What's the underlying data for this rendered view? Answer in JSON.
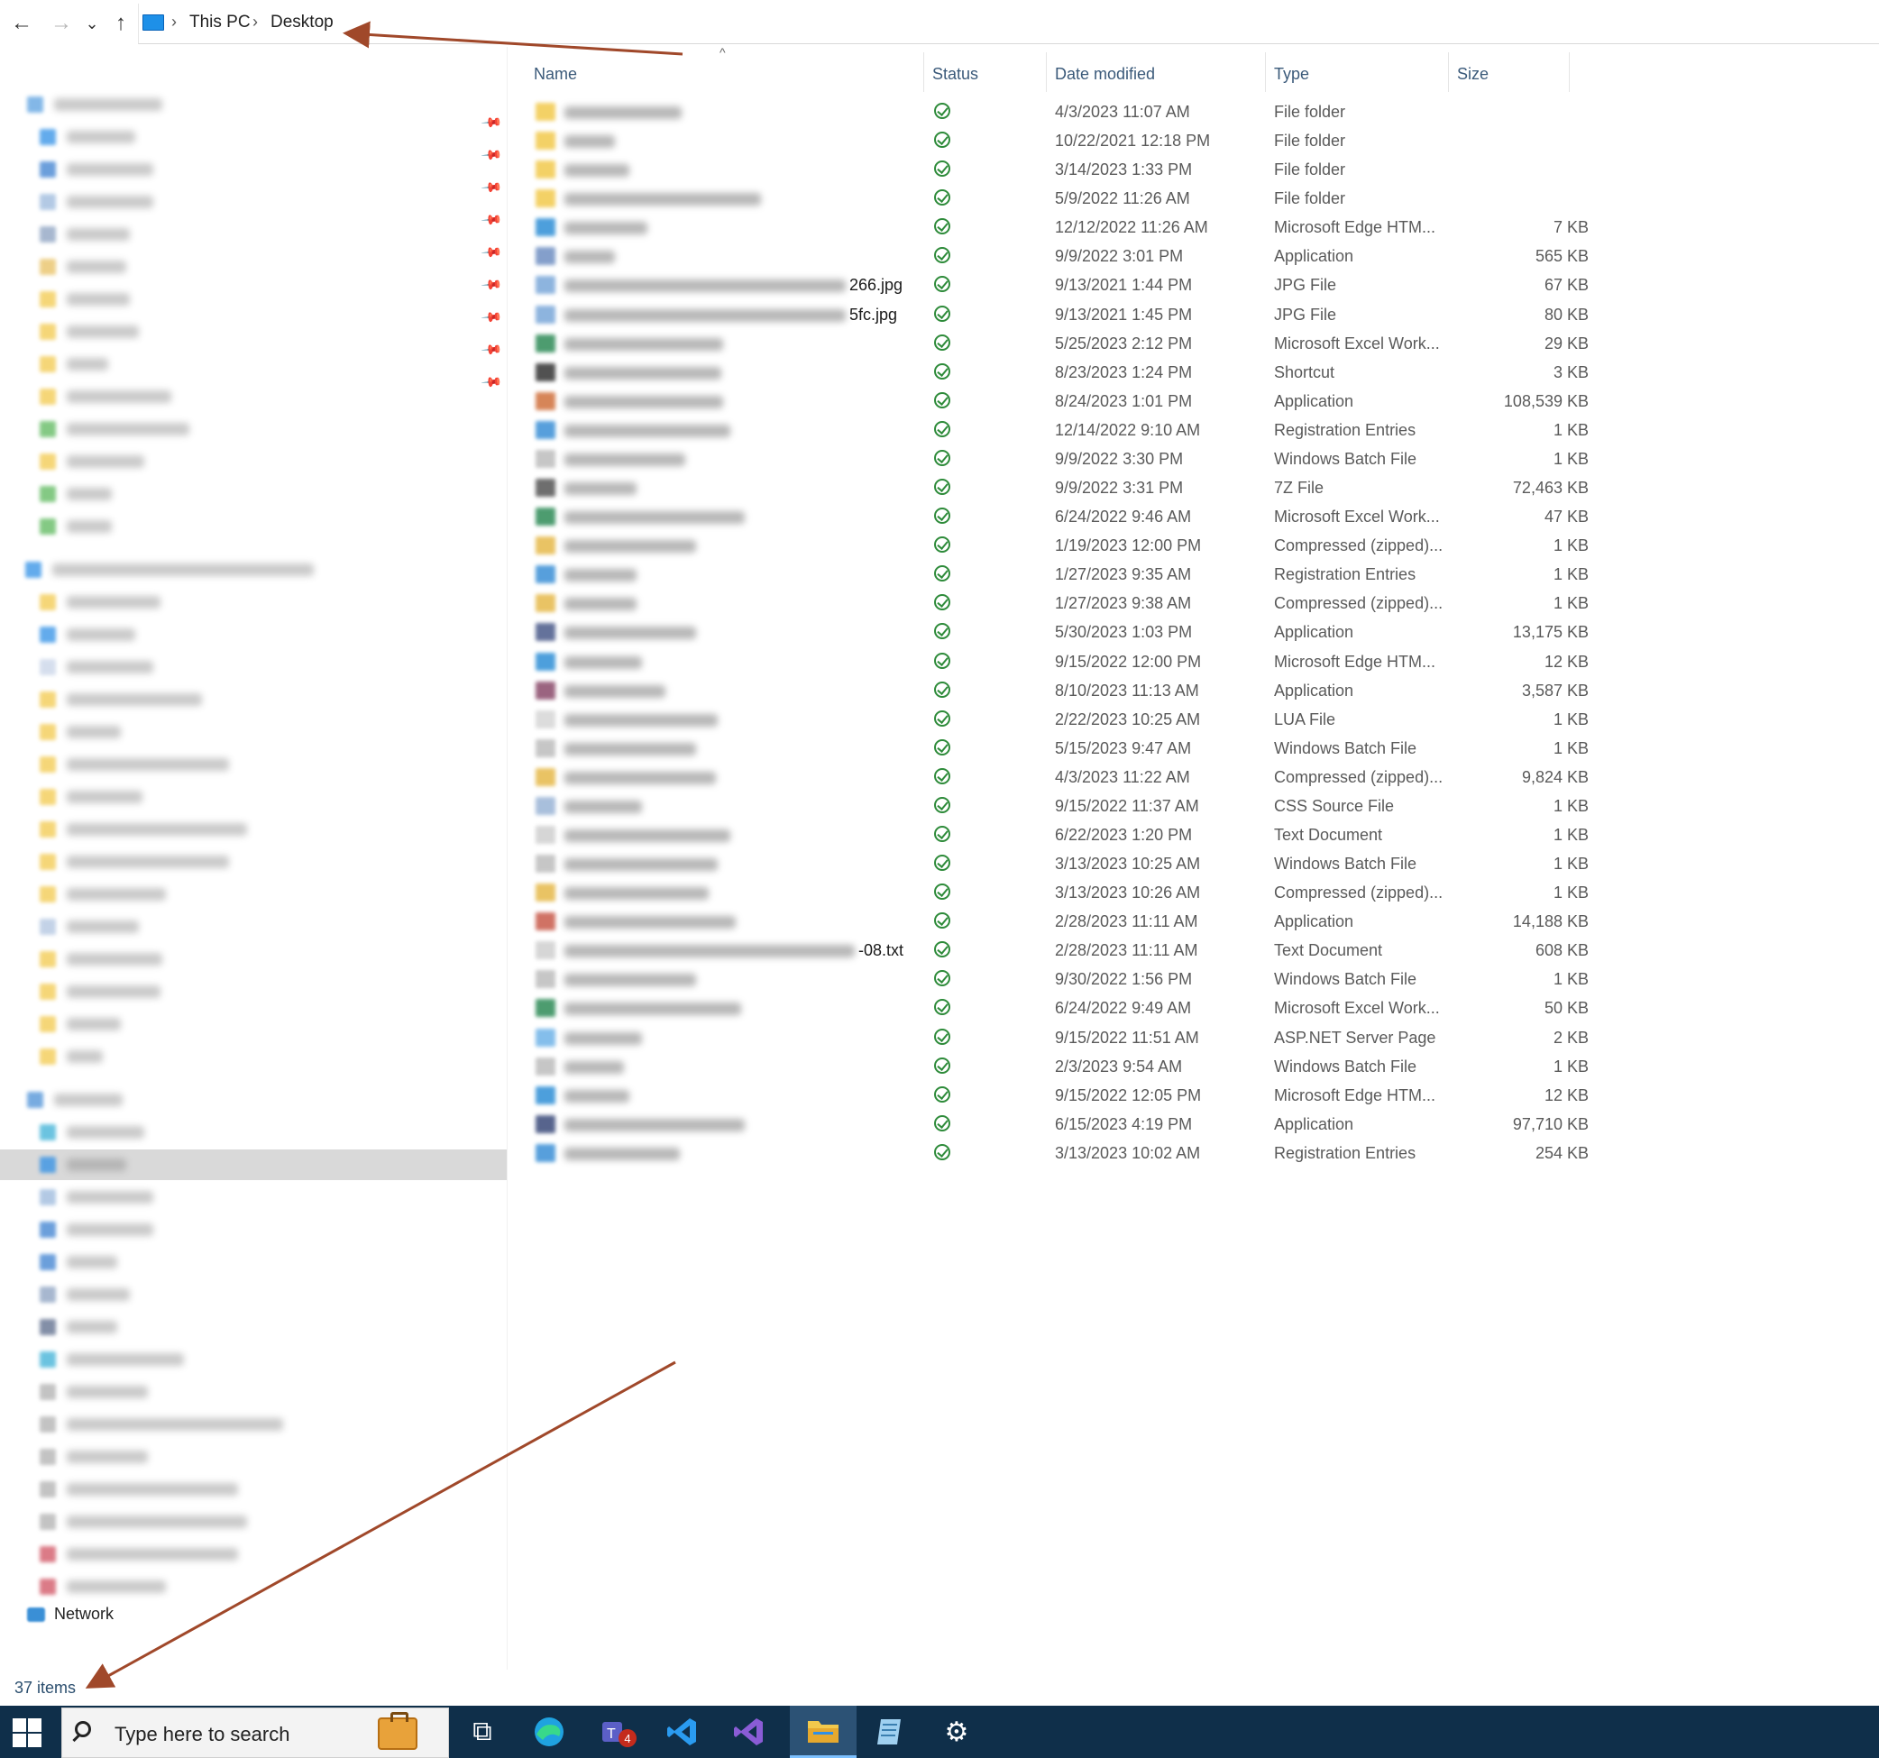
{
  "addressbar": {
    "back_glyph": "←",
    "forward_glyph": "→",
    "recent_glyph": "⌄",
    "up_glyph": "↑",
    "breadcrumb": [
      "This PC",
      "Desktop"
    ],
    "separator": "›"
  },
  "columns": {
    "name": "Name",
    "status": "Status",
    "date": "Date modified",
    "type": "Type",
    "size": "Size"
  },
  "sort_caret": "^",
  "files": [
    {
      "suffix": "",
      "date": "4/3/2023 11:07 AM",
      "type": "File folder",
      "size": "",
      "icon": "folder-icon",
      "color": "#f2c94c"
    },
    {
      "suffix": "",
      "date": "10/22/2021 12:18 PM",
      "type": "File folder",
      "size": "",
      "icon": "folder-icon",
      "color": "#f2c94c"
    },
    {
      "suffix": "",
      "date": "3/14/2023 1:33 PM",
      "type": "File folder",
      "size": "",
      "icon": "folder-icon",
      "color": "#f2c94c"
    },
    {
      "suffix": "",
      "date": "5/9/2022 11:26 AM",
      "type": "File folder",
      "size": "",
      "icon": "folder-icon",
      "color": "#f2c94c"
    },
    {
      "suffix": "",
      "date": "12/12/2022 11:26 AM",
      "type": "Microsoft Edge HTM...",
      "size": "7 KB",
      "icon": "edge-html-icon",
      "color": "#2f8fd6"
    },
    {
      "suffix": "",
      "date": "9/9/2022 3:01 PM",
      "type": "Application",
      "size": "565 KB",
      "icon": "application-icon",
      "color": "#6f8fc2"
    },
    {
      "suffix": "266.jpg",
      "date": "9/13/2021 1:44 PM",
      "type": "JPG File",
      "size": "67 KB",
      "icon": "image-icon",
      "color": "#7aa7d9"
    },
    {
      "suffix": "5fc.jpg",
      "date": "9/13/2021 1:45 PM",
      "type": "JPG File",
      "size": "80 KB",
      "icon": "image-icon",
      "color": "#7aa7d9"
    },
    {
      "suffix": "",
      "date": "5/25/2023 2:12 PM",
      "type": "Microsoft Excel Work...",
      "size": "29 KB",
      "icon": "excel-icon",
      "color": "#2e8b57"
    },
    {
      "suffix": "",
      "date": "8/23/2023 1:24 PM",
      "type": "Shortcut",
      "size": "3 KB",
      "icon": "shortcut-icon",
      "color": "#333333"
    },
    {
      "suffix": "",
      "date": "8/24/2023 1:01 PM",
      "type": "Application",
      "size": "108,539 KB",
      "icon": "application-icon",
      "color": "#d0703c"
    },
    {
      "suffix": "",
      "date": "12/14/2022 9:10 AM",
      "type": "Registration Entries",
      "size": "1 KB",
      "icon": "registry-icon",
      "color": "#3a8fd6"
    },
    {
      "suffix": "",
      "date": "9/9/2022 3:30 PM",
      "type": "Windows Batch File",
      "size": "1 KB",
      "icon": "batch-icon",
      "color": "#bdbdbd"
    },
    {
      "suffix": "",
      "date": "9/9/2022 3:31 PM",
      "type": "7Z File",
      "size": "72,463 KB",
      "icon": "archive-icon",
      "color": "#555555"
    },
    {
      "suffix": "",
      "date": "6/24/2022 9:46 AM",
      "type": "Microsoft Excel Work...",
      "size": "47 KB",
      "icon": "excel-icon",
      "color": "#2e8b57"
    },
    {
      "suffix": "",
      "date": "1/19/2023 12:00 PM",
      "type": "Compressed (zipped)...",
      "size": "1 KB",
      "icon": "zip-icon",
      "color": "#e6b94a"
    },
    {
      "suffix": "",
      "date": "1/27/2023 9:35 AM",
      "type": "Registration Entries",
      "size": "1 KB",
      "icon": "registry-icon",
      "color": "#3a8fd6"
    },
    {
      "suffix": "",
      "date": "1/27/2023 9:38 AM",
      "type": "Compressed (zipped)...",
      "size": "1 KB",
      "icon": "zip-icon",
      "color": "#e6b94a"
    },
    {
      "suffix": "",
      "date": "5/30/2023 1:03 PM",
      "type": "Application",
      "size": "13,175 KB",
      "icon": "application-icon",
      "color": "#4a5a8a"
    },
    {
      "suffix": "",
      "date": "9/15/2022 12:00 PM",
      "type": "Microsoft Edge HTM...",
      "size": "12 KB",
      "icon": "edge-html-icon",
      "color": "#2f8fd6"
    },
    {
      "suffix": "",
      "date": "8/10/2023 11:13 AM",
      "type": "Application",
      "size": "3,587 KB",
      "icon": "application-icon",
      "color": "#8a4a6a"
    },
    {
      "suffix": "",
      "date": "2/22/2023 10:25 AM",
      "type": "LUA File",
      "size": "1 KB",
      "icon": "file-icon",
      "color": "#d6d6d6"
    },
    {
      "suffix": "",
      "date": "5/15/2023 9:47 AM",
      "type": "Windows Batch File",
      "size": "1 KB",
      "icon": "batch-icon",
      "color": "#bdbdbd"
    },
    {
      "suffix": "",
      "date": "4/3/2023 11:22 AM",
      "type": "Compressed (zipped)...",
      "size": "9,824 KB",
      "icon": "zip-icon",
      "color": "#e6b94a"
    },
    {
      "suffix": "",
      "date": "9/15/2022 11:37 AM",
      "type": "CSS Source File",
      "size": "1 KB",
      "icon": "css-icon",
      "color": "#9ab4d6"
    },
    {
      "suffix": "",
      "date": "6/22/2023 1:20 PM",
      "type": "Text Document",
      "size": "1 KB",
      "icon": "text-icon",
      "color": "#cfcfcf"
    },
    {
      "suffix": "",
      "date": "3/13/2023 10:25 AM",
      "type": "Windows Batch File",
      "size": "1 KB",
      "icon": "batch-icon",
      "color": "#bdbdbd"
    },
    {
      "suffix": "",
      "date": "3/13/2023 10:26 AM",
      "type": "Compressed (zipped)...",
      "size": "1 KB",
      "icon": "zip-icon",
      "color": "#e6b94a"
    },
    {
      "suffix": "",
      "date": "2/28/2023 11:11 AM",
      "type": "Application",
      "size": "14,188 KB",
      "icon": "application-icon",
      "color": "#c85a4a"
    },
    {
      "suffix": "-08.txt",
      "date": "2/28/2023 11:11 AM",
      "type": "Text Document",
      "size": "608 KB",
      "icon": "text-icon",
      "color": "#cfcfcf"
    },
    {
      "suffix": "",
      "date": "9/30/2022 1:56 PM",
      "type": "Windows Batch File",
      "size": "1 KB",
      "icon": "batch-icon",
      "color": "#bdbdbd"
    },
    {
      "suffix": "",
      "date": "6/24/2022 9:49 AM",
      "type": "Microsoft Excel Work...",
      "size": "50 KB",
      "icon": "excel-icon",
      "color": "#2e8b57"
    },
    {
      "suffix": "",
      "date": "9/15/2022 11:51 AM",
      "type": "ASP.NET Server Page",
      "size": "2 KB",
      "icon": "web-page-icon",
      "color": "#6fb3e8"
    },
    {
      "suffix": "",
      "date": "2/3/2023 9:54 AM",
      "type": "Windows Batch File",
      "size": "1 KB",
      "icon": "batch-icon",
      "color": "#bdbdbd"
    },
    {
      "suffix": "",
      "date": "9/15/2022 12:05 PM",
      "type": "Microsoft Edge HTM...",
      "size": "12 KB",
      "icon": "edge-html-icon",
      "color": "#2f8fd6"
    },
    {
      "suffix": "",
      "date": "6/15/2023 4:19 PM",
      "type": "Application",
      "size": "97,710 KB",
      "icon": "application-icon",
      "color": "#3a4a7a"
    },
    {
      "suffix": "",
      "date": "3/13/2023 10:02 AM",
      "type": "Registration Entries",
      "size": "254 KB",
      "icon": "registry-icon",
      "color": "#3a8fd6"
    }
  ],
  "sidebar": {
    "network_label": "Network"
  },
  "statusbar": {
    "item_count": "37 items"
  },
  "taskbar": {
    "search_placeholder": "Type here to search",
    "teams_badge": "4",
    "taskview_glyph": "⧉",
    "settings_glyph": "⚙"
  },
  "colors": {
    "accent": "#0f2f4a",
    "status_ok": "#2e8b3a",
    "annotation": "#a0482a",
    "selected_row": "#d9d9d9"
  }
}
